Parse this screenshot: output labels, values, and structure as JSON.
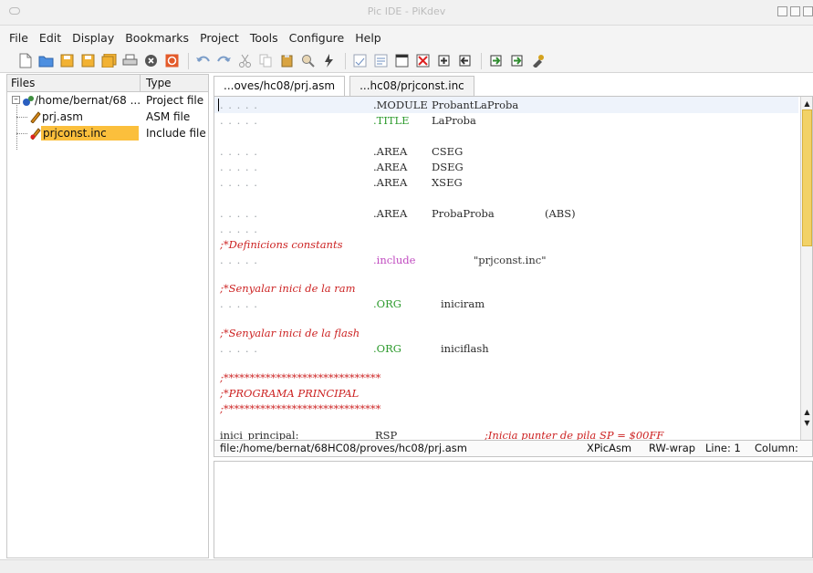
{
  "window": {
    "title": "Pic IDE - PiKdev"
  },
  "menu": [
    "File",
    "Edit",
    "Display",
    "Bookmarks",
    "Project",
    "Tools",
    "Configure",
    "Help"
  ],
  "toolbar": {
    "icons": [
      "new-file-icon",
      "open-file-icon",
      "save-icon",
      "save-as-icon",
      "save-all-icon",
      "print-icon",
      "close-icon",
      "stop-icon",
      "undo-icon",
      "redo-icon",
      "cut-icon",
      "copy-icon",
      "paste-icon",
      "find-icon",
      "build-icon",
      "project-new-icon",
      "project-open-icon",
      "project-add-icon",
      "project-remove-icon",
      "program-icon",
      "read-icon",
      "erase-icon",
      "burn-icon",
      "verify-icon"
    ]
  },
  "files_panel": {
    "col_files": "Files",
    "col_type": "Type",
    "rows": [
      {
        "name": "/home/bernat/68 ...",
        "type": "Project file"
      },
      {
        "name": "prj.asm",
        "type": "ASM file"
      },
      {
        "name": "prjconst.inc",
        "type": "Include file"
      }
    ]
  },
  "tabs": [
    {
      "label": "...oves/hc08/prj.asm"
    },
    {
      "label": "...hc08/prjconst.inc"
    }
  ],
  "editor": {
    "dots": ". . . . .",
    "lines": [
      {
        "dir": ".MODULE",
        "arg": "ProbantLaProba"
      },
      {
        "dir": ".TITLE",
        "arg": "LaProba"
      },
      {
        "dir": ".AREA",
        "arg": "CSEG"
      },
      {
        "dir": ".AREA",
        "arg": "DSEG"
      },
      {
        "dir": ".AREA",
        "arg": "XSEG"
      },
      {
        "dir": ".AREA",
        "arg": "ProbaProba",
        "extra": "(ABS)"
      },
      {
        "comment": ";*Definicions constants"
      },
      {
        "dir": ".include",
        "arg": "\"prjconst.inc\""
      },
      {
        "comment": ";*Senyalar inici de la ram"
      },
      {
        "dir": ".ORG",
        "arg": "iniciram"
      },
      {
        "comment": ";*Senyalar inici de la flash"
      },
      {
        "dir": ".ORG",
        "arg": "iniciflash"
      },
      {
        "comment": ";******************************"
      },
      {
        "comment": ";*PROGRAMA PRINCIPAL"
      },
      {
        "comment": ";******************************"
      },
      {
        "partial_left": "inici_principal:",
        "partial_mid": "RSP",
        "partial_comment": ";Inicia punter de pila SP = $00FF"
      }
    ]
  },
  "status": {
    "path": "file:/home/bernat/68HC08/proves/hc08/prj.asm",
    "mode": "XPicAsm",
    "wrap": "RW-wrap",
    "line": "Line: 1",
    "column": "Column:"
  }
}
